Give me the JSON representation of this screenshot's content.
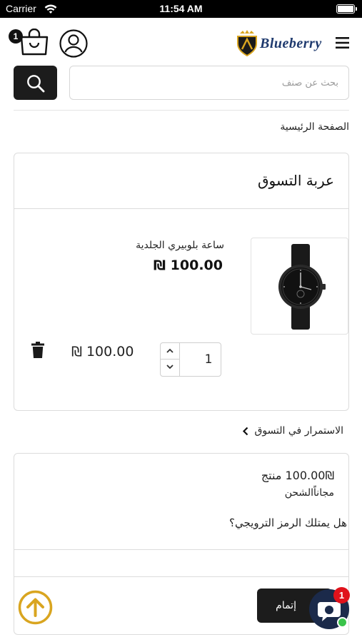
{
  "status_bar": {
    "carrier": "Carrier",
    "time": "11:54 AM"
  },
  "header": {
    "logo_text": "Blueberry",
    "cart_count": "1"
  },
  "search": {
    "placeholder": "بحث عن صنف",
    "value": ""
  },
  "breadcrumb": {
    "home": "الصفحة الرئيسية"
  },
  "cart": {
    "title": "عربة التسوق",
    "items": [
      {
        "name": "ساعة بلوبيري الجلدية",
        "price": "₪ 100.00",
        "quantity": "1",
        "line_total": "₪ 100.00"
      }
    ]
  },
  "continue_shopping": "الاستمرار في التسوق",
  "summary": {
    "products_line": "100.00₪ منتج",
    "shipping_line": "مجاناًالشحن",
    "promo_question": "هل يمتلك الرمز الترويجي؟",
    "checkout_label": "إتمام الطلب"
  },
  "chat": {
    "unread_count": "1"
  },
  "colors": {
    "accent_dark": "#1c1c1c",
    "logo_blue": "#1f3a6e",
    "logo_gold": "#d9a520",
    "scroll_top_gold": "#d9a520",
    "chat_blue": "#1b2a4a",
    "badge_red": "#e0121b",
    "online_green": "#3ac34a"
  },
  "icons": {
    "wifi": "wifi-icon",
    "battery": "battery-icon",
    "cart": "shopping-bag-icon",
    "user": "user-icon",
    "menu": "hamburger-menu-icon",
    "search": "search-icon",
    "trash": "trash-icon",
    "back": "chevron-left-icon",
    "scroll_top": "arrow-up-circle-icon",
    "chat": "chat-bubble-icon"
  }
}
